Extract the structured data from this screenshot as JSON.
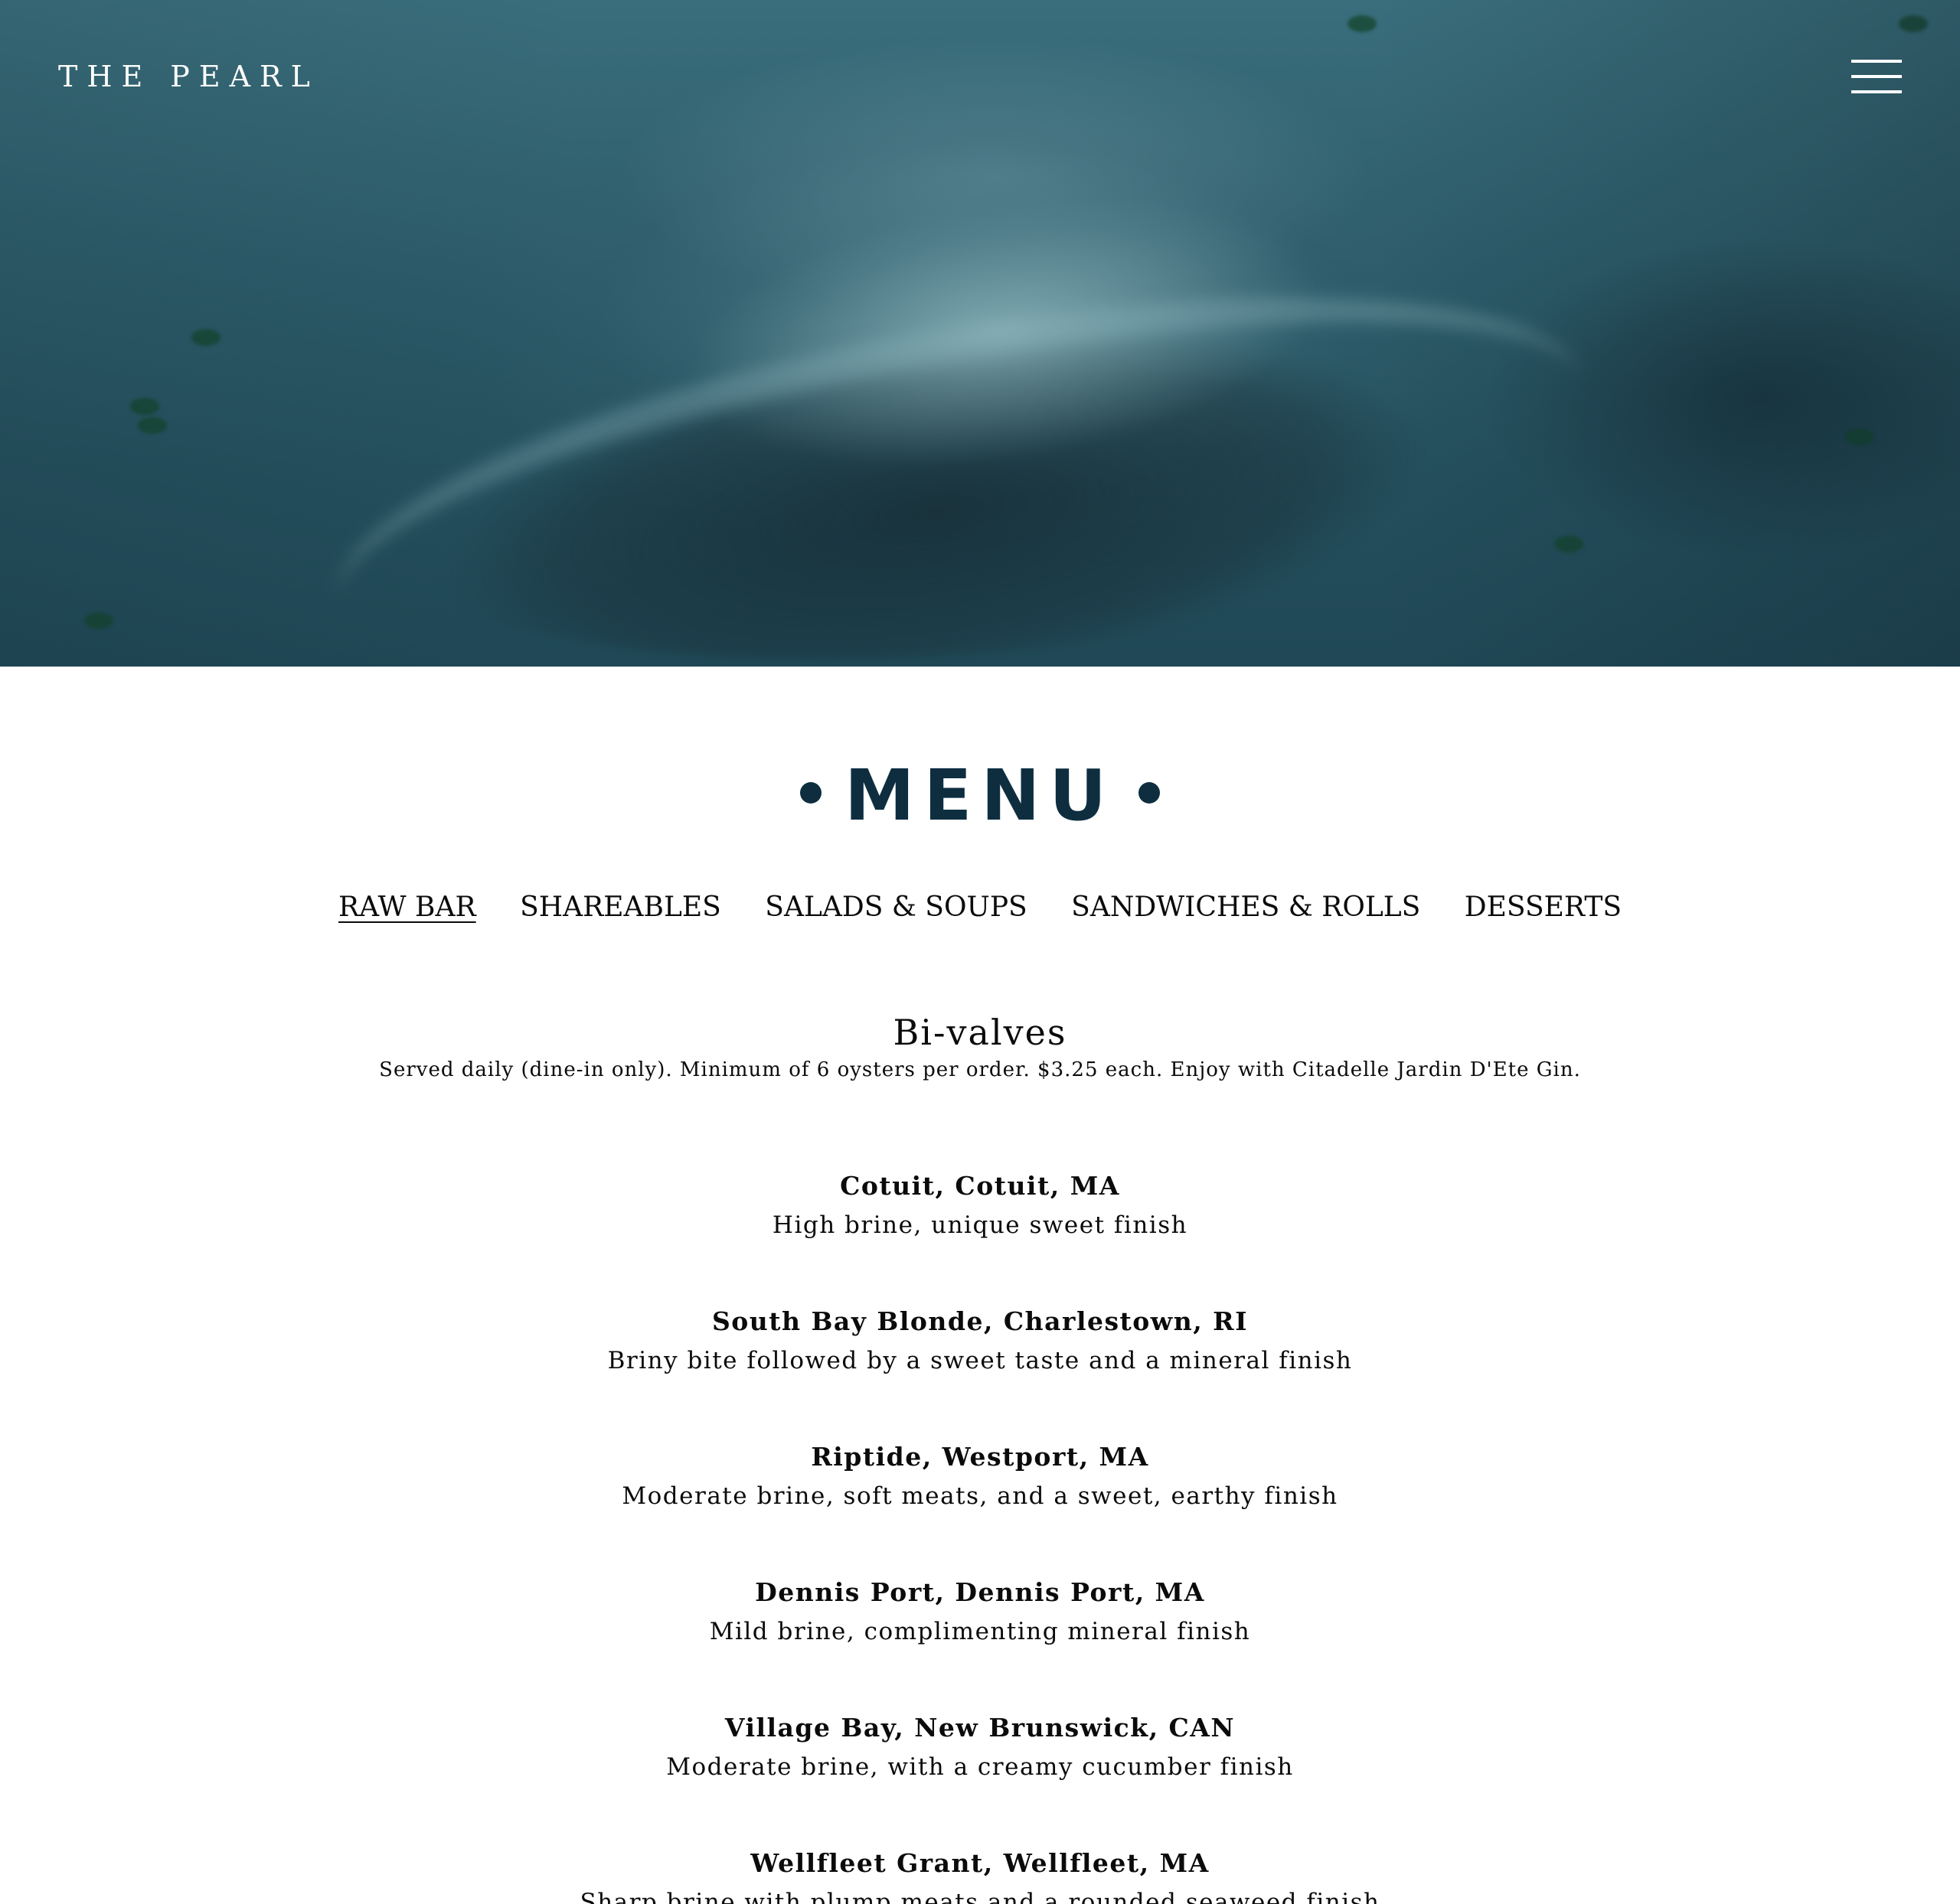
{
  "header": {
    "brand": "THE PEARL",
    "menu_icon": "hamburger-menu-icon"
  },
  "hero": {
    "image_subject": "oyster-photo",
    "tint": "#2d5c6a"
  },
  "page": {
    "title": "MENU",
    "accent_color": "#0e2e40"
  },
  "tabs": [
    {
      "label": "RAW BAR",
      "active": true
    },
    {
      "label": "SHAREABLES",
      "active": false
    },
    {
      "label": "SALADS & SOUPS",
      "active": false
    },
    {
      "label": "SANDWICHES & ROLLS",
      "active": false
    },
    {
      "label": "DESSERTS",
      "active": false
    }
  ],
  "section": {
    "title": "Bi-valves",
    "note": "Served daily (dine-in only). Minimum of 6 oysters per order. $3.25 each. Enjoy with Citadelle Jardin D'Ete Gin."
  },
  "items": [
    {
      "name": "Cotuit, Cotuit, MA",
      "desc": "High brine, unique sweet finish"
    },
    {
      "name": "South Bay Blonde, Charlestown, RI",
      "desc": "Briny bite followed by a sweet taste and a mineral finish"
    },
    {
      "name": "Riptide, Westport, MA",
      "desc": "Moderate brine, soft meats, and a sweet, earthy finish"
    },
    {
      "name": "Dennis Port, Dennis Port, MA",
      "desc": "Mild brine, complimenting mineral finish"
    },
    {
      "name": "Village Bay, New Brunswick, CAN",
      "desc": "Moderate brine, with a creamy cucumber finish"
    },
    {
      "name": "Wellfleet Grant, Wellfleet, MA",
      "desc": "Sharp brine with plump meats and a rounded seaweed finish"
    }
  ]
}
